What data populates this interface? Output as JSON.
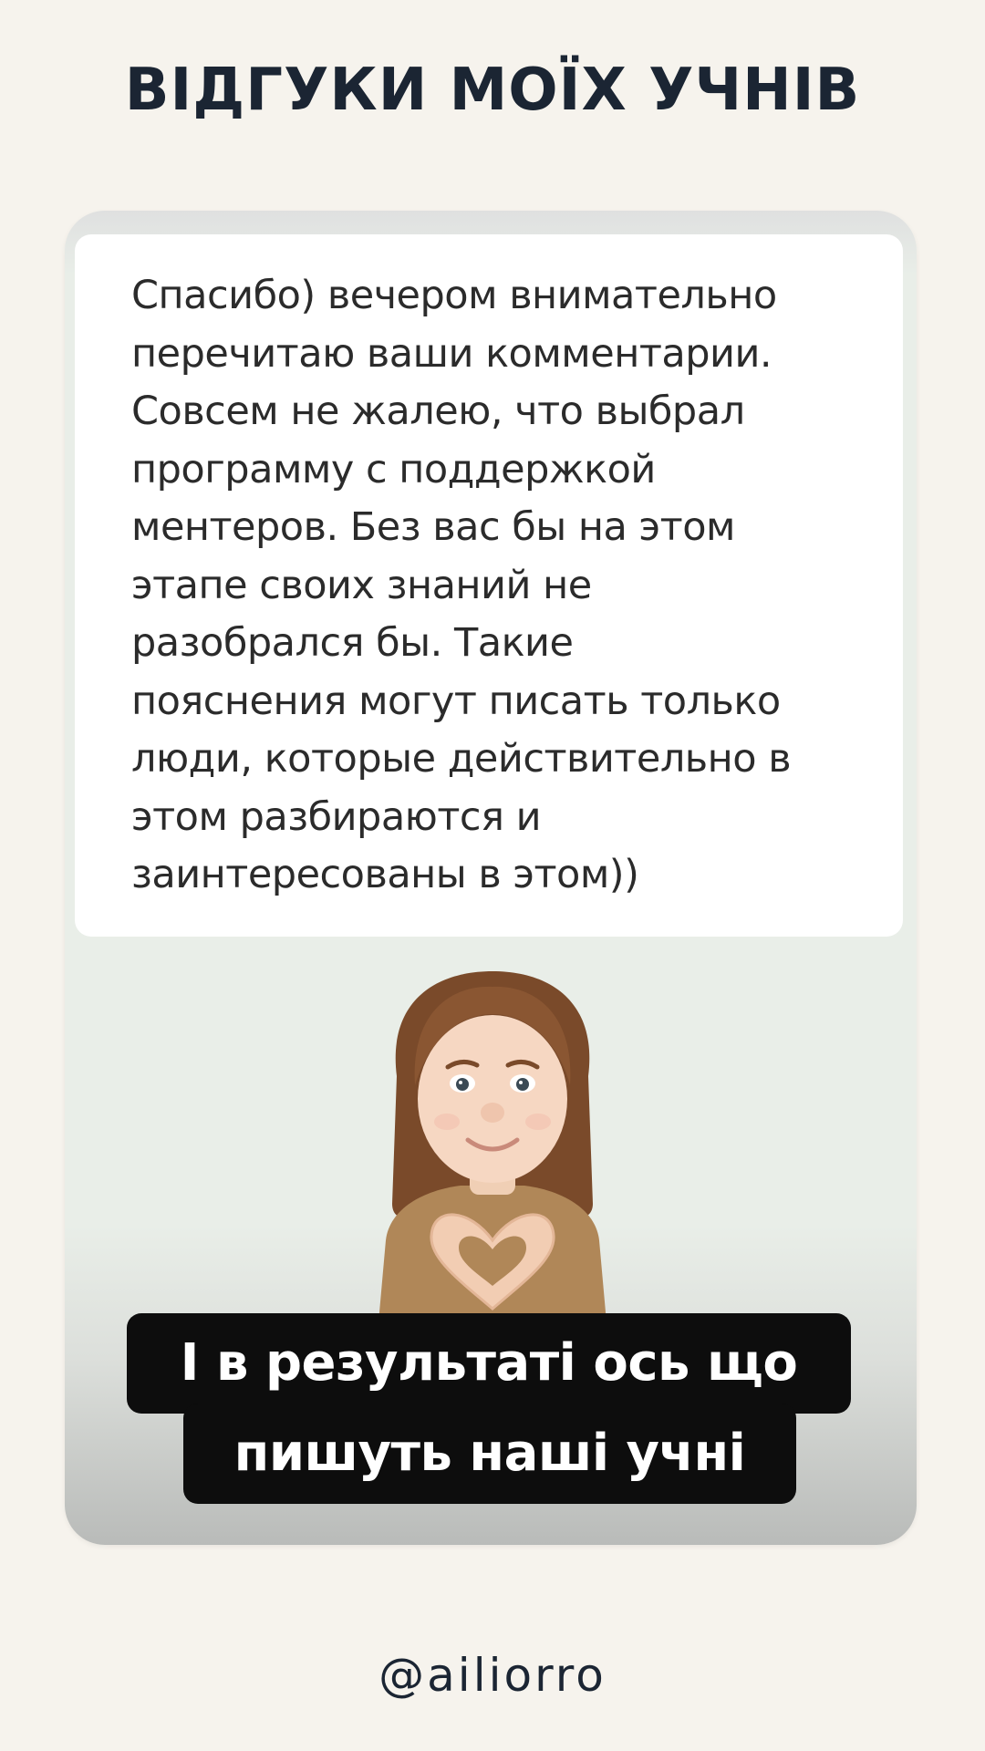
{
  "header": {
    "title": "ВІДГУКИ МОЇХ УЧНІВ"
  },
  "review": {
    "text": "Спасибо) вечером внимательно\nперечитаю ваши комментарии.\nСовсем не жалею, что выбрал\nпрограмму с поддержкой\nментеров. Без вас бы на этом\nэтапе своих знаний не\nразобрался бы. Такие\nпояснения могут писать только\nлюди, которые действительно в\nэтом разбираются и\nзаинтересованы в этом))"
  },
  "caption": {
    "line1": "І в результаті ось що",
    "line2": "пишуть наші учні"
  },
  "footer": {
    "handle": "@ailiorro"
  },
  "colors": {
    "background": "#f6f3ed",
    "title": "#1b2533",
    "card_bg": "#e9eee8",
    "caption_bg": "#0d0d0d"
  },
  "icons": {
    "avatar": "memoji-heart-hands-avatar"
  }
}
